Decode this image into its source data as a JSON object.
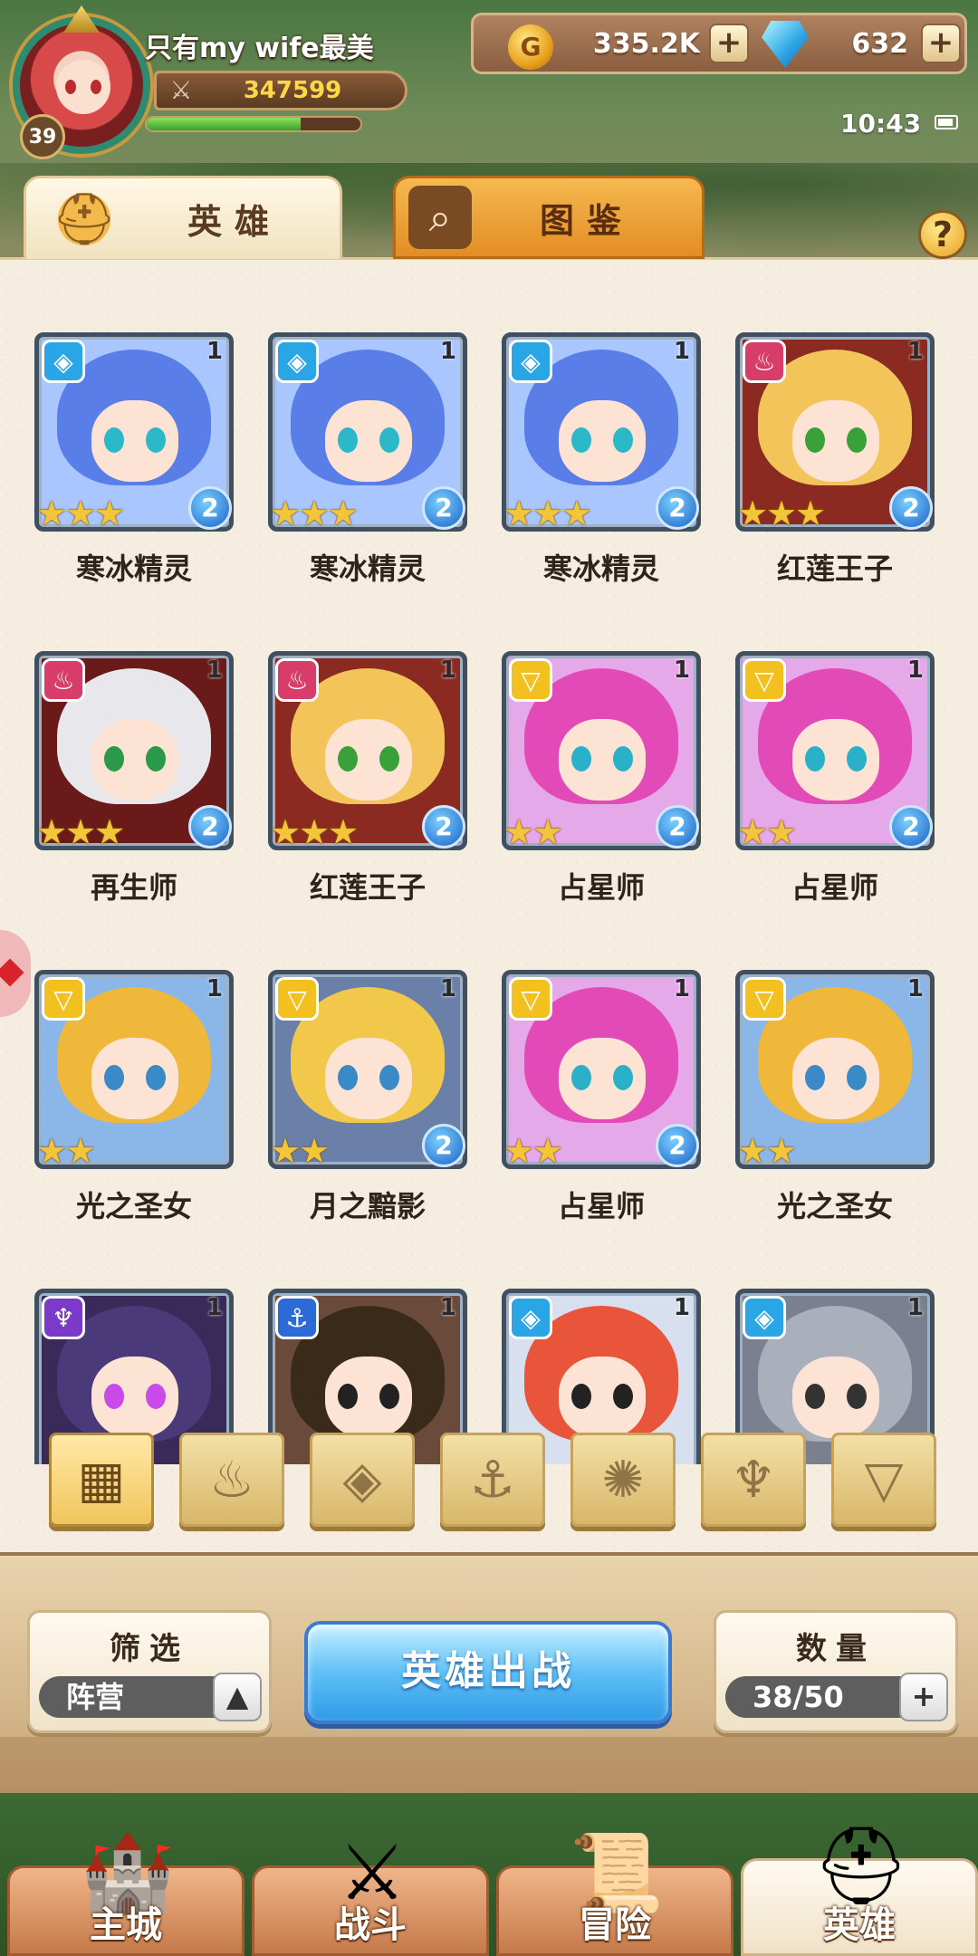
{
  "player": {
    "name": "只有my wife最美",
    "level": "39",
    "power": "347599",
    "exp_fraction": 0.72
  },
  "currency": {
    "gold": "335.2K",
    "gems": "632"
  },
  "status": {
    "time": "10:43"
  },
  "tabs": [
    {
      "label": "英雄",
      "active": true
    },
    {
      "label": "图鉴",
      "active": false
    }
  ],
  "help_label": "?",
  "heroes": [
    {
      "name": "寒冰精灵",
      "faction": "water",
      "faction_glyph": "◈",
      "level": "1",
      "stars": 3,
      "rank": "2",
      "palette": "ice"
    },
    {
      "name": "寒冰精灵",
      "faction": "water",
      "faction_glyph": "◈",
      "level": "1",
      "stars": 3,
      "rank": "2",
      "palette": "ice"
    },
    {
      "name": "寒冰精灵",
      "faction": "water",
      "faction_glyph": "◈",
      "level": "1",
      "stars": 3,
      "rank": "2",
      "palette": "ice"
    },
    {
      "name": "红莲王子",
      "faction": "fire",
      "faction_glyph": "♨",
      "level": "1",
      "stars": 3,
      "rank": "2",
      "palette": "prince"
    },
    {
      "name": "再生师",
      "faction": "fire",
      "faction_glyph": "♨",
      "level": "1",
      "stars": 3,
      "rank": "2",
      "palette": "healer"
    },
    {
      "name": "红莲王子",
      "faction": "fire",
      "faction_glyph": "♨",
      "level": "1",
      "stars": 3,
      "rank": "2",
      "palette": "prince"
    },
    {
      "name": "占星师",
      "faction": "light",
      "faction_glyph": "▽",
      "level": "1",
      "stars": 2,
      "rank": "2",
      "palette": "astro"
    },
    {
      "name": "占星师",
      "faction": "light",
      "faction_glyph": "▽",
      "level": "1",
      "stars": 2,
      "rank": "2",
      "palette": "astro"
    },
    {
      "name": "光之圣女",
      "faction": "light",
      "faction_glyph": "▽",
      "level": "1",
      "stars": 2,
      "rank": "",
      "palette": "saint"
    },
    {
      "name": "月之黯影",
      "faction": "light",
      "faction_glyph": "▽",
      "level": "1",
      "stars": 2,
      "rank": "2",
      "palette": "moon"
    },
    {
      "name": "占星师",
      "faction": "light",
      "faction_glyph": "▽",
      "level": "1",
      "stars": 2,
      "rank": "2",
      "palette": "astro"
    },
    {
      "name": "光之圣女",
      "faction": "light",
      "faction_glyph": "▽",
      "level": "1",
      "stars": 2,
      "rank": "",
      "palette": "saint"
    },
    {
      "name": "",
      "faction": "dark",
      "faction_glyph": "♆",
      "level": "1",
      "stars": 0,
      "rank": "",
      "palette": "dark"
    },
    {
      "name": "",
      "faction": "sea",
      "faction_glyph": "⚓",
      "level": "1",
      "stars": 0,
      "rank": "",
      "palette": "pirate"
    },
    {
      "name": "",
      "faction": "water",
      "faction_glyph": "◈",
      "level": "1",
      "stars": 0,
      "rank": "",
      "palette": "beast"
    },
    {
      "name": "",
      "faction": "water",
      "faction_glyph": "◈",
      "level": "1",
      "stars": 0,
      "rank": "",
      "palette": "knight"
    }
  ],
  "faction_filters": [
    {
      "icon": "all-grid-icon",
      "glyph": "▦",
      "active": true
    },
    {
      "icon": "fire-faction-icon",
      "glyph": "♨",
      "active": false
    },
    {
      "icon": "water-faction-icon",
      "glyph": "◈",
      "active": false
    },
    {
      "icon": "anchor-faction-icon",
      "glyph": "⚓",
      "active": false
    },
    {
      "icon": "beast-faction-icon",
      "glyph": "✺",
      "active": false
    },
    {
      "icon": "dark-faction-icon",
      "glyph": "♆",
      "active": false
    },
    {
      "icon": "light-faction-icon",
      "glyph": "▽",
      "active": false
    }
  ],
  "filter": {
    "title": "筛选",
    "value": "阵营"
  },
  "sortie_label": "英雄出战",
  "count": {
    "title": "数量",
    "value": "38/50"
  },
  "nav": [
    {
      "label": "主城",
      "icon": "city-icon",
      "glyph": "🏰",
      "active": false
    },
    {
      "label": "战斗",
      "icon": "crossed-swords-icon",
      "glyph": "⚔",
      "active": false
    },
    {
      "label": "冒险",
      "icon": "map-scroll-icon",
      "glyph": "📜",
      "active": false
    },
    {
      "label": "英雄",
      "icon": "hero-helmet-icon",
      "glyph": "⛑",
      "active": true
    }
  ],
  "colors": {
    "water": "#2aa6e6",
    "fire": "#d83d6a",
    "light": "#f2c11f",
    "dark": "#7b3ac8",
    "sea": "#2c6ad8"
  }
}
